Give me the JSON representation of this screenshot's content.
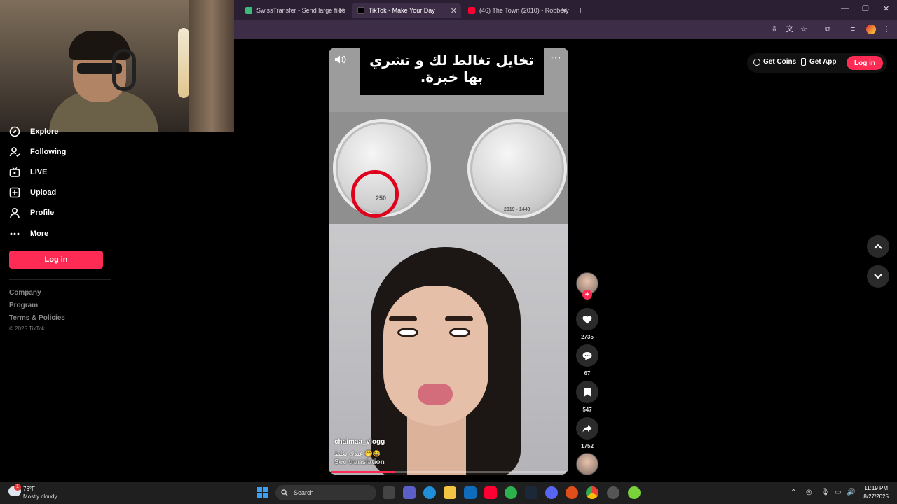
{
  "browser": {
    "tabs": [
      {
        "label": "SwissTransfer - Send large files",
        "active": false,
        "icon_color": "#3dbb79"
      },
      {
        "label": "TikTok - Make Your Day",
        "active": true,
        "icon_color": "#000000"
      },
      {
        "label": "(46) The Town (2010) - Robbery",
        "active": false,
        "icon_color": "#ff0033"
      }
    ],
    "new_tab": "+"
  },
  "sidebar": {
    "items": [
      {
        "label": "Explore",
        "icon": "compass-icon"
      },
      {
        "label": "Following",
        "icon": "person-follow-icon"
      },
      {
        "label": "LIVE",
        "icon": "live-tv-icon"
      },
      {
        "label": "Upload",
        "icon": "plus-square-icon"
      },
      {
        "label": "Profile",
        "icon": "person-icon"
      },
      {
        "label": "More",
        "icon": "more-dots-icon"
      }
    ],
    "login_label": "Log in",
    "footer_links": [
      "Company",
      "Program",
      "Terms & Policies"
    ],
    "copyright": "© 2025 TikTok"
  },
  "topbar": {
    "get_coins": "Get Coins",
    "get_app": "Get App",
    "login": "Log in"
  },
  "video": {
    "caption": "تخايل تغالط لك و تشري بها خبزة.",
    "coin_value": "250",
    "coin_year": "2019 - 1440",
    "username": "chaimaa_vlogg",
    "description": "عندك تغلط 🤭😂",
    "see_translation": "See translation",
    "progress": 0.27
  },
  "actions": {
    "likes": "2735",
    "comments": "67",
    "saves": "547",
    "shares": "1752"
  },
  "taskbar": {
    "weather_temp": "76°F",
    "weather_desc": "Mostly cloudy",
    "weather_badge": "1",
    "search_placeholder": "Search",
    "time": "11:19 PM",
    "date": "8/27/2025"
  },
  "colors": {
    "accent": "#fe2c55",
    "tabstrip": "#2b1f33",
    "toolbar": "#3d2d47"
  }
}
